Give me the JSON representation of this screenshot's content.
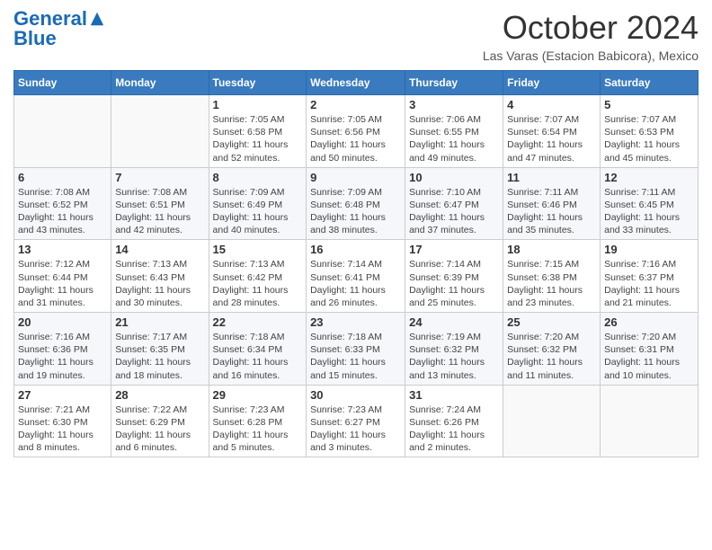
{
  "header": {
    "logo_general": "General",
    "logo_blue": "Blue",
    "month_title": "October 2024",
    "location": "Las Varas (Estacion Babicora), Mexico"
  },
  "days_of_week": [
    "Sunday",
    "Monday",
    "Tuesday",
    "Wednesday",
    "Thursday",
    "Friday",
    "Saturday"
  ],
  "weeks": [
    [
      {
        "day": "",
        "info": ""
      },
      {
        "day": "",
        "info": ""
      },
      {
        "day": "1",
        "info": "Sunrise: 7:05 AM\nSunset: 6:58 PM\nDaylight: 11 hours and 52 minutes."
      },
      {
        "day": "2",
        "info": "Sunrise: 7:05 AM\nSunset: 6:56 PM\nDaylight: 11 hours and 50 minutes."
      },
      {
        "day": "3",
        "info": "Sunrise: 7:06 AM\nSunset: 6:55 PM\nDaylight: 11 hours and 49 minutes."
      },
      {
        "day": "4",
        "info": "Sunrise: 7:07 AM\nSunset: 6:54 PM\nDaylight: 11 hours and 47 minutes."
      },
      {
        "day": "5",
        "info": "Sunrise: 7:07 AM\nSunset: 6:53 PM\nDaylight: 11 hours and 45 minutes."
      }
    ],
    [
      {
        "day": "6",
        "info": "Sunrise: 7:08 AM\nSunset: 6:52 PM\nDaylight: 11 hours and 43 minutes."
      },
      {
        "day": "7",
        "info": "Sunrise: 7:08 AM\nSunset: 6:51 PM\nDaylight: 11 hours and 42 minutes."
      },
      {
        "day": "8",
        "info": "Sunrise: 7:09 AM\nSunset: 6:49 PM\nDaylight: 11 hours and 40 minutes."
      },
      {
        "day": "9",
        "info": "Sunrise: 7:09 AM\nSunset: 6:48 PM\nDaylight: 11 hours and 38 minutes."
      },
      {
        "day": "10",
        "info": "Sunrise: 7:10 AM\nSunset: 6:47 PM\nDaylight: 11 hours and 37 minutes."
      },
      {
        "day": "11",
        "info": "Sunrise: 7:11 AM\nSunset: 6:46 PM\nDaylight: 11 hours and 35 minutes."
      },
      {
        "day": "12",
        "info": "Sunrise: 7:11 AM\nSunset: 6:45 PM\nDaylight: 11 hours and 33 minutes."
      }
    ],
    [
      {
        "day": "13",
        "info": "Sunrise: 7:12 AM\nSunset: 6:44 PM\nDaylight: 11 hours and 31 minutes."
      },
      {
        "day": "14",
        "info": "Sunrise: 7:13 AM\nSunset: 6:43 PM\nDaylight: 11 hours and 30 minutes."
      },
      {
        "day": "15",
        "info": "Sunrise: 7:13 AM\nSunset: 6:42 PM\nDaylight: 11 hours and 28 minutes."
      },
      {
        "day": "16",
        "info": "Sunrise: 7:14 AM\nSunset: 6:41 PM\nDaylight: 11 hours and 26 minutes."
      },
      {
        "day": "17",
        "info": "Sunrise: 7:14 AM\nSunset: 6:39 PM\nDaylight: 11 hours and 25 minutes."
      },
      {
        "day": "18",
        "info": "Sunrise: 7:15 AM\nSunset: 6:38 PM\nDaylight: 11 hours and 23 minutes."
      },
      {
        "day": "19",
        "info": "Sunrise: 7:16 AM\nSunset: 6:37 PM\nDaylight: 11 hours and 21 minutes."
      }
    ],
    [
      {
        "day": "20",
        "info": "Sunrise: 7:16 AM\nSunset: 6:36 PM\nDaylight: 11 hours and 19 minutes."
      },
      {
        "day": "21",
        "info": "Sunrise: 7:17 AM\nSunset: 6:35 PM\nDaylight: 11 hours and 18 minutes."
      },
      {
        "day": "22",
        "info": "Sunrise: 7:18 AM\nSunset: 6:34 PM\nDaylight: 11 hours and 16 minutes."
      },
      {
        "day": "23",
        "info": "Sunrise: 7:18 AM\nSunset: 6:33 PM\nDaylight: 11 hours and 15 minutes."
      },
      {
        "day": "24",
        "info": "Sunrise: 7:19 AM\nSunset: 6:32 PM\nDaylight: 11 hours and 13 minutes."
      },
      {
        "day": "25",
        "info": "Sunrise: 7:20 AM\nSunset: 6:32 PM\nDaylight: 11 hours and 11 minutes."
      },
      {
        "day": "26",
        "info": "Sunrise: 7:20 AM\nSunset: 6:31 PM\nDaylight: 11 hours and 10 minutes."
      }
    ],
    [
      {
        "day": "27",
        "info": "Sunrise: 7:21 AM\nSunset: 6:30 PM\nDaylight: 11 hours and 8 minutes."
      },
      {
        "day": "28",
        "info": "Sunrise: 7:22 AM\nSunset: 6:29 PM\nDaylight: 11 hours and 6 minutes."
      },
      {
        "day": "29",
        "info": "Sunrise: 7:23 AM\nSunset: 6:28 PM\nDaylight: 11 hours and 5 minutes."
      },
      {
        "day": "30",
        "info": "Sunrise: 7:23 AM\nSunset: 6:27 PM\nDaylight: 11 hours and 3 minutes."
      },
      {
        "day": "31",
        "info": "Sunrise: 7:24 AM\nSunset: 6:26 PM\nDaylight: 11 hours and 2 minutes."
      },
      {
        "day": "",
        "info": ""
      },
      {
        "day": "",
        "info": ""
      }
    ]
  ]
}
